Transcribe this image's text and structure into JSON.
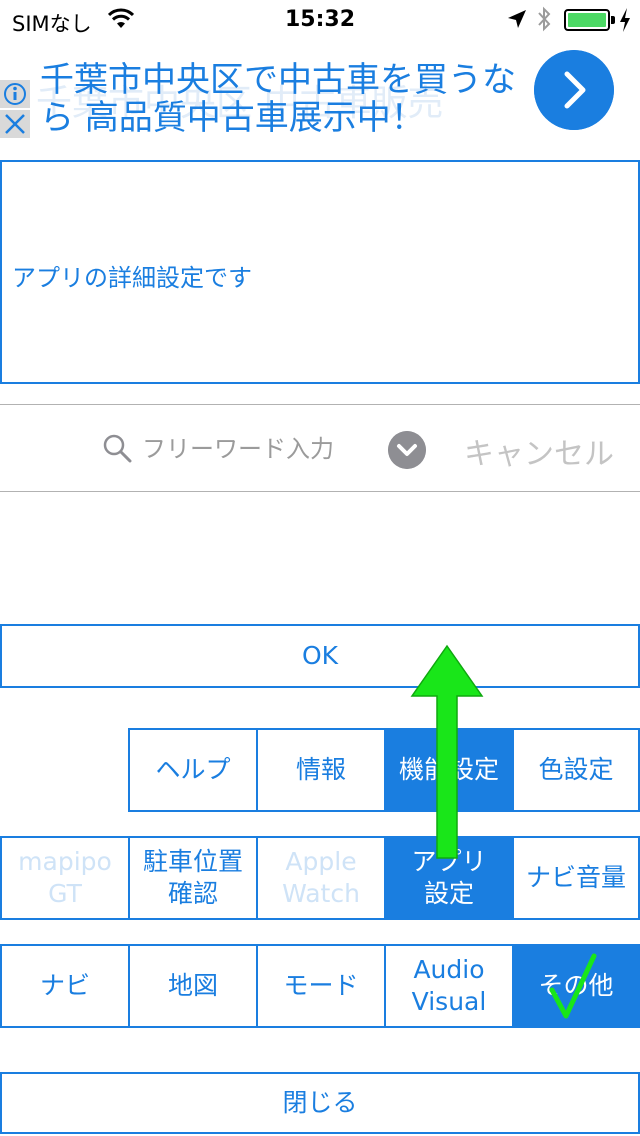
{
  "status_bar": {
    "carrier": "SIMなし",
    "time": "15:32"
  },
  "ad": {
    "line1": "千葉市中央区で中古車を買うな",
    "line2": "ら 高品質中古車展示中！",
    "ghost": "千葉市中央区 中古車販売"
  },
  "description": "アプリの詳細設定です",
  "search": {
    "placeholder": "フリーワード入力",
    "cancel_label": "キャンセル"
  },
  "ok_label": "OK",
  "rows": {
    "row1": [
      "ヘルプ",
      "情報",
      "機能設定",
      "色設定"
    ],
    "row2": [
      "mapipo\nGT",
      "駐車位置\n確認",
      "Apple\nWatch",
      "アプリ\n設定",
      "ナビ音量"
    ],
    "row3": [
      "ナビ",
      "地図",
      "モード",
      "Audio\nVisual",
      "その他"
    ]
  },
  "close_label": "閉じる",
  "colors": {
    "accent": "#1a7ee0",
    "selected_bg": "#1a7ee0",
    "disabled_text": "#cfe3f7",
    "overlay_green": "#19e619"
  }
}
